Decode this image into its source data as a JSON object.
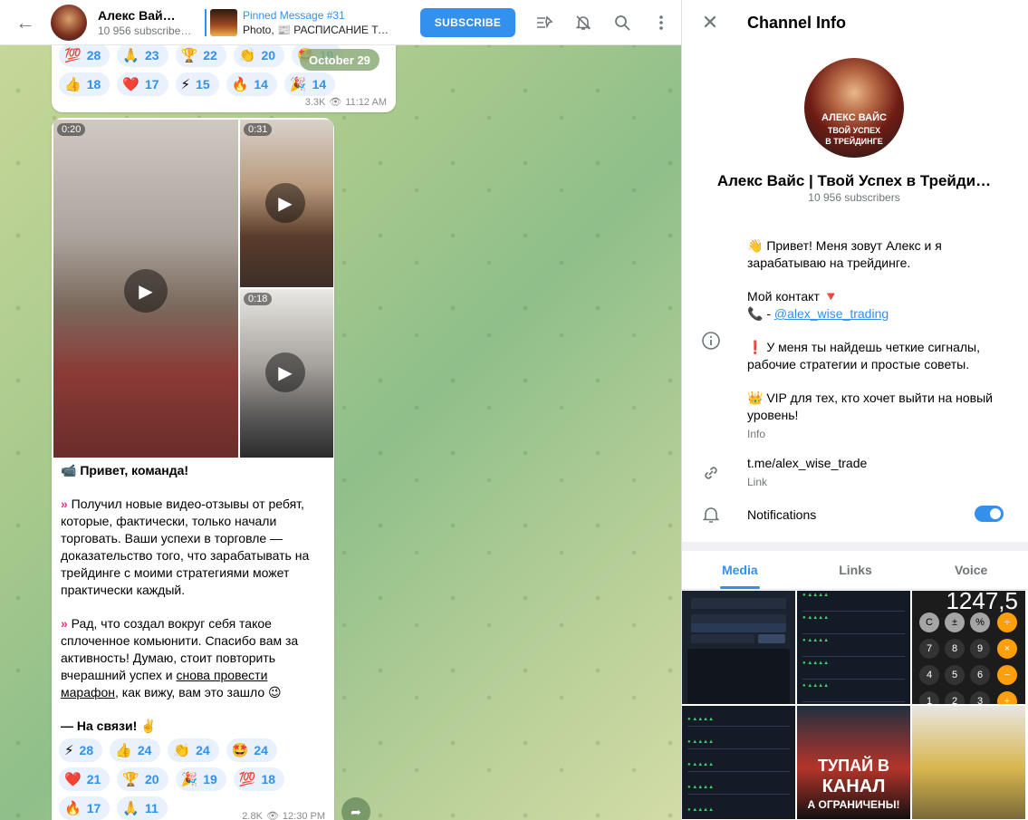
{
  "header": {
    "channel_name": "Алекс Вай…",
    "subscribers": "10 956 subscribe…",
    "pinned_title": "Pinned Message #31",
    "pinned_sub": "Photo, 📰 РАСПИСАНИЕ ТОРГ…",
    "subscribe_label": "SUBSCRIBE"
  },
  "bubble1": {
    "reactions_row1": [
      {
        "emoji": "💯",
        "count": "28"
      },
      {
        "emoji": "🙏",
        "count": "23"
      },
      {
        "emoji": "🏆",
        "count": "22"
      },
      {
        "emoji": "👏",
        "count": "20"
      },
      {
        "emoji": "🤩",
        "count": "19"
      }
    ],
    "reactions_row2": [
      {
        "emoji": "👍",
        "count": "18"
      },
      {
        "emoji": "❤️",
        "count": "17"
      },
      {
        "emoji": "⚡",
        "count": "15"
      },
      {
        "emoji": "🔥",
        "count": "14"
      },
      {
        "emoji": "🎉",
        "count": "14"
      }
    ],
    "views": "3.3K",
    "time": "11:12 AM"
  },
  "date_pill": "October 29",
  "bubble2": {
    "video1_duration": "0:20",
    "video2_duration": "0:31",
    "video3_duration": "0:18",
    "para1": "📹 Привет, команда!",
    "para2_arrow": "»",
    "para2": " Получил новые видео-отзывы от ребят, которые, фактически, только начали торговать. Ваши успехи в торговле — доказательство того, что зарабатывать на трейдинге с моими стратегиями может практически каждый.",
    "para3_arrow": "»",
    "para3_start": " Рад, что создал вокруг себя такое сплоченное комьюнити. Спасибо вам за активность! Думаю, стоит повторить вчерашний успех и ",
    "para3_link": "снова провести марафон",
    "para3_end": ", как вижу, вам это зашло 😉",
    "para4": "— На связи! ✌️",
    "reactions_row1": [
      {
        "emoji": "⚡",
        "count": "28"
      },
      {
        "emoji": "👍",
        "count": "24"
      },
      {
        "emoji": "👏",
        "count": "24"
      },
      {
        "emoji": "🤩",
        "count": "24"
      }
    ],
    "reactions_row2": [
      {
        "emoji": "❤️",
        "count": "21"
      },
      {
        "emoji": "🏆",
        "count": "20"
      },
      {
        "emoji": "🎉",
        "count": "19"
      },
      {
        "emoji": "💯",
        "count": "18"
      }
    ],
    "reactions_row3": [
      {
        "emoji": "🔥",
        "count": "17"
      },
      {
        "emoji": "🙏",
        "count": "11"
      }
    ],
    "views": "2.8K",
    "time": "12:30 PM"
  },
  "panel": {
    "title": "Channel Info",
    "avatar_line1": "АЛЕКС ВАЙС",
    "avatar_line2": "ТВОЙ УСПЕХ",
    "avatar_line3": "В ТРЕЙДИНГЕ",
    "channel_full_name": "Алекс Вайс | Твой Успех в Трейди…",
    "channel_subs": "10 956 subscribers",
    "info_p1": "👋 Привет! Меня зовут Алекс и я зарабатываю на трейдинге.",
    "info_p2_line1": "Мой контакт 🔻",
    "info_p2_prefix": "📞 - ",
    "info_p2_link": "@alex_wise_trading",
    "info_p3": "❗ У меня ты найдешь четкие сигналы, рабочие стратегии и простые советы.",
    "info_p4": "👑 VIP для тех, кто хочет выйти на новый уровень!",
    "info_label": "Info",
    "link_value": "t.me/alex_wise_trade",
    "link_label": "Link",
    "notifications_label": "Notifications",
    "tabs": [
      "Media",
      "Links",
      "Voice"
    ],
    "calc_display": "1247,5",
    "media5_text1": "ТУПАЙ В",
    "media5_text2": "КАНАЛ",
    "media5_text3": "А ОГРАНИЧЕНЫ!"
  },
  "colors": {
    "accent": "#3390ec",
    "reaction_bg": "#e8f1fc"
  }
}
